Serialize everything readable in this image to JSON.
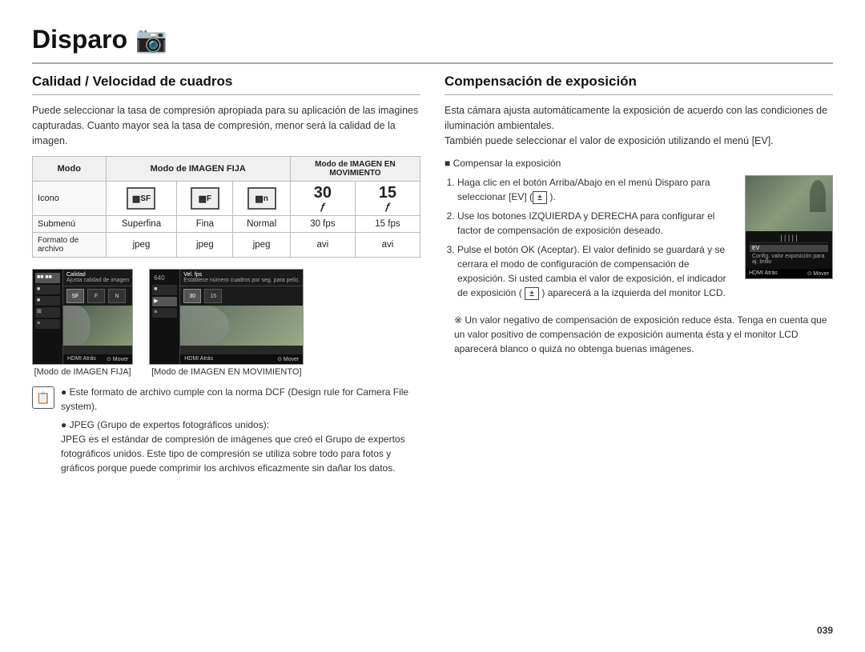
{
  "page": {
    "title": "Disparo",
    "camera_icon": "📷",
    "page_number": "039"
  },
  "left": {
    "section_title": "Calidad / Velocidad de cuadros",
    "intro_text": "Puede seleccionar la tasa de compresión apropiada para su aplicación de las imagines capturadas. Cuanto mayor sea la tasa de compresión, menor será la calidad de la imagen.",
    "table": {
      "headers": [
        "Modo",
        "Modo de IMAGEN FIJA",
        "",
        "",
        "Modo de IMAGEN EN MOVIMIENTO",
        ""
      ],
      "rows": [
        {
          "label": "Modo",
          "cols": [
            "Modo de IMAGEN FIJA",
            "Modo de IMAGEN EN MOVIMIENTO"
          ]
        },
        {
          "label": "Icono",
          "cols": [
            "SF_icon",
            "F_icon",
            "N_icon",
            "30_fps_icon",
            "15_fps_icon"
          ]
        },
        {
          "label": "Submenú",
          "cols": [
            "Superfina",
            "Fina",
            "Normal",
            "30 fps",
            "15 fps"
          ]
        },
        {
          "label": "Formato de archivo",
          "cols": [
            "jpeg",
            "jpeg",
            "jpeg",
            "avi",
            "avi"
          ]
        }
      ]
    },
    "screenshot1": {
      "label": "[Modo de IMAGEN FIJA]",
      "bottom_left": "Atrás",
      "bottom_right": "Mover",
      "menu_item": "Calidad",
      "menu_sub": "Ajusta calidad de imagen"
    },
    "screenshot2": {
      "label": "[Modo de IMAGEN EN MOVIMIENTO]",
      "resolution": "640",
      "bottom_left": "Atrás",
      "bottom_right": "Mover",
      "menu_item": "Vel. fps",
      "menu_sub": "Establece número cuadros por seg. para pelíc."
    },
    "note": {
      "bullets": [
        "Este formato de archivo cumple con la norma DCF (Design rule for Camera File system).",
        "JPEG (Grupo de expertos fotográficos unidos): JPEG es el estándar de compresión de imágenes que creó el Grupo de expertos fotográficos unidos. Este tipo de compresión se utiliza sobre todo para fotos y gráficos porque puede comprimir los archivos eficazmente sin dañar los datos."
      ]
    }
  },
  "right": {
    "section_title": "Compensación de exposición",
    "intro_text1": "Esta cámara ajusta automáticamente la exposición de acuerdo con las condiciones de iluminación ambientales.",
    "intro_text2": "También puede seleccionar el valor de exposición utilizando el menú [EV].",
    "bullet_heading": "Compensar la exposición",
    "steps": [
      {
        "num": 1,
        "text": "Haga clic en el botón Arriba/Abajo en el menú Disparo para seleccionar [EV] ("
      },
      {
        "num": 2,
        "text": "Use los botones IZQUIERDA y DERECHA para configurar el factor de compensación de exposición deseado."
      },
      {
        "num": 3,
        "text": "Pulse el botón OK (Aceptar). El valor definido se guardará y se cerrara el modo de configuración de compensación de exposición. Si usted cambia el valor de exposición, el indicador de exposición (",
        "text2": ") aparecerá a la izquierda del monitor LCD."
      }
    ],
    "screenshot": {
      "ev_label": "EV",
      "menu_rows": [
        {
          "text": "EV",
          "highlighted": true
        },
        {
          "text": "Config. valor exposición para aj. brillo",
          "highlighted": false
        }
      ],
      "bottom_left": "Atrás",
      "bottom_right": "Mover"
    },
    "warning": "Un valor negativo de compensación de exposición reduce ésta. Tenga en cuenta que un valor positivo de compensación de exposición aumenta ésta y el monitor LCD aparecerá blanco o quizá no obtenga buenas imágenes."
  }
}
